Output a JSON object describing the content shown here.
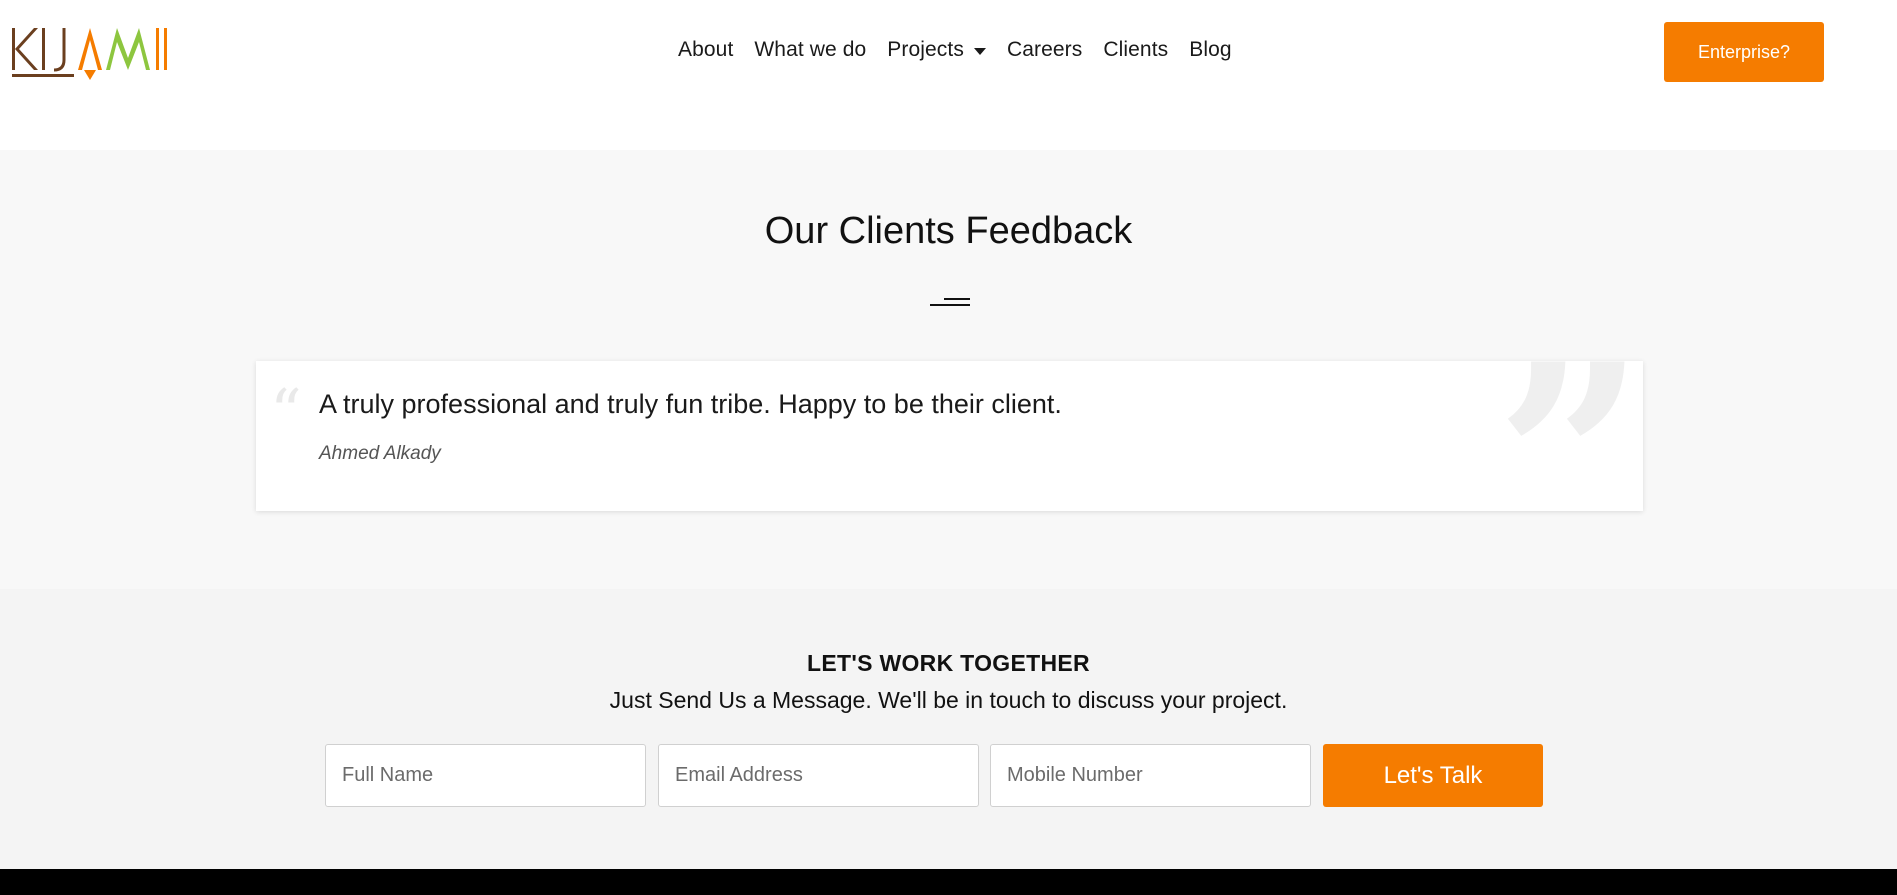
{
  "brand": {
    "logo_text": "KIJAMII",
    "colors": {
      "brown": "#6b3f1f",
      "orange": "#f57c00",
      "green": "#8dc63f"
    }
  },
  "nav": {
    "items": [
      {
        "label": "About"
      },
      {
        "label": "What we do"
      },
      {
        "label": "Projects",
        "has_dropdown": true
      },
      {
        "label": "Careers"
      },
      {
        "label": "Clients"
      },
      {
        "label": "Blog"
      }
    ],
    "cta_label": "Enterprise?"
  },
  "feedback": {
    "title": "Our Clients Feedback",
    "testimonial": {
      "quote": "A truly professional and truly fun tribe. Happy to be their client.",
      "author": "Ahmed Alkady"
    }
  },
  "contact": {
    "heading": "LET'S WORK TOGETHER",
    "subheading": "Just Send Us a Message. We'll be in touch to discuss your project.",
    "fields": {
      "full_name_placeholder": "Full Name",
      "email_placeholder": "Email Address",
      "mobile_placeholder": "Mobile Number"
    },
    "submit_label": "Let's Talk"
  },
  "accent_color": "#f57c00"
}
